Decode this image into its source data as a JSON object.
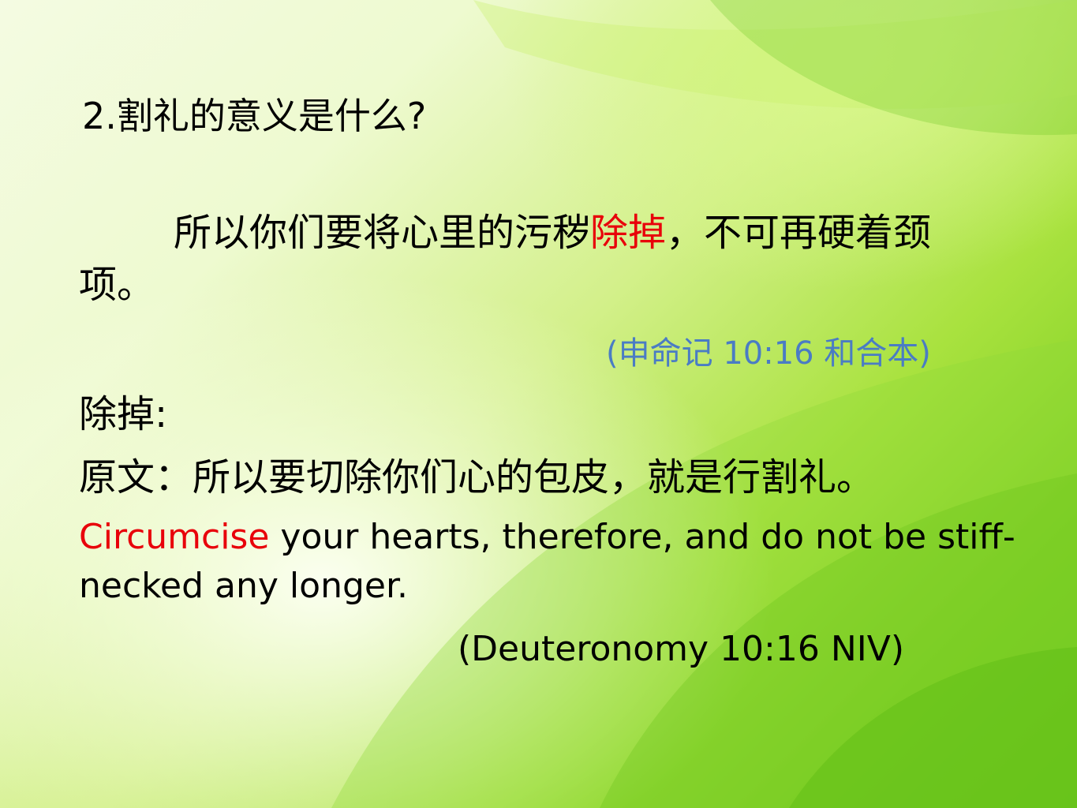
{
  "slide": {
    "title": "2.割礼的意义是什么?",
    "cn_verse": {
      "part1": "所以你们要将心里的污秽",
      "highlight": "除掉",
      "part2": "，不可再硬着颈项。"
    },
    "cn_reference": "(申命记 10:16 和合本)",
    "label": "除掉:",
    "original": "原文：所以要切除你们心的包皮，就是行割礼。",
    "en_verse": {
      "highlight": "Circumcise",
      "rest": " your hearts, therefore, and do not be stiff-necked any longer."
    },
    "en_reference": "(Deuteronomy 10:16 NIV)"
  },
  "colors": {
    "highlight": "#e8000a",
    "reference": "#4a7cc4",
    "background_green": "#7fd022"
  }
}
